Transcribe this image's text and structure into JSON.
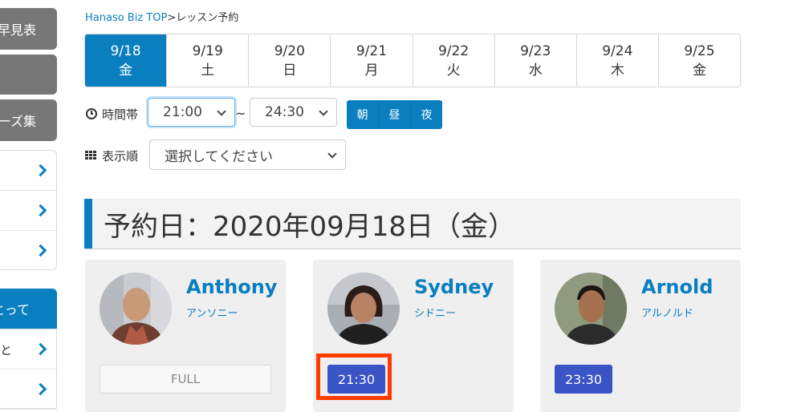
{
  "sidebar": {
    "top_buttons": [
      "早見表",
      "",
      "ーズ集"
    ],
    "blue_item": "とって",
    "list2_items": [
      "と",
      ""
    ]
  },
  "breadcrumb": {
    "home": "Hanaso Biz TOP",
    "separator": ">",
    "current": "レッスン予約"
  },
  "date_tabs": [
    {
      "date": "9/18",
      "day": "金",
      "active": true
    },
    {
      "date": "9/19",
      "day": "土",
      "active": false
    },
    {
      "date": "9/20",
      "day": "日",
      "active": false
    },
    {
      "date": "9/21",
      "day": "月",
      "active": false
    },
    {
      "date": "9/22",
      "day": "火",
      "active": false
    },
    {
      "date": "9/23",
      "day": "水",
      "active": false
    },
    {
      "date": "9/24",
      "day": "木",
      "active": false
    },
    {
      "date": "9/25",
      "day": "金",
      "active": false
    }
  ],
  "filters": {
    "time_label": "時間帯",
    "time_from": "21:00",
    "tilde": "~",
    "time_to": "24:30",
    "periods": [
      "朝",
      "昼",
      "夜"
    ],
    "order_label": "表示順",
    "order_value": "選択してください"
  },
  "heading": "予約日：2020年09月18日（金）",
  "teachers": [
    {
      "name": "Anthony",
      "kana": "アンソニー",
      "slot": "FULL",
      "full": true
    },
    {
      "name": "Sydney",
      "kana": "シドニー",
      "slot": "21:30",
      "full": false
    },
    {
      "name": "Arnold",
      "kana": "アルノルド",
      "slot": "23:30",
      "full": false
    }
  ],
  "colors": {
    "accent": "#0a7fc0",
    "slot_button": "#3a53c5",
    "highlight": "#ff3b00"
  }
}
